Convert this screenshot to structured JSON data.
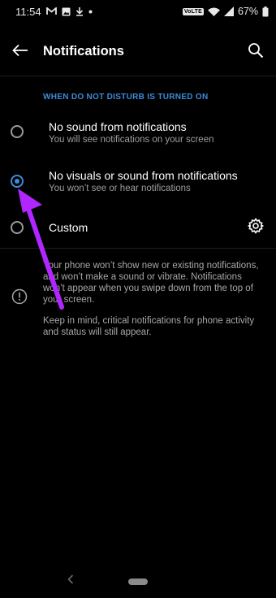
{
  "status_bar": {
    "time": "11:54",
    "volte_label": "VoLTE",
    "battery_percent": "67%",
    "left_icons": [
      "gmail-icon",
      "image-icon",
      "download-icon",
      "notification-dot-icon"
    ],
    "right_icons": [
      "wifi-icon",
      "signal-icon",
      "battery-icon"
    ]
  },
  "app_bar": {
    "title": "Notifications",
    "back_icon": "arrow-left-icon",
    "search_icon": "search-icon"
  },
  "section": {
    "header": "WHEN DO NOT DISTURB IS TURNED ON"
  },
  "options": [
    {
      "title": "No sound from notifications",
      "subtitle": "You will see notifications on your screen",
      "selected": false
    },
    {
      "title": "No visuals or sound from notifications",
      "subtitle": "You won’t see or hear notifications",
      "selected": true
    },
    {
      "title": "Custom",
      "subtitle": "",
      "selected": false
    }
  ],
  "info": {
    "paragraph1": "Your phone won’t show new or existing notifications, and won’t make a sound or vibrate. Notifications won’t appear when you swipe down from the top of your screen.",
    "paragraph2": "Keep in mind, critical notifications for phone activity and status will still appear."
  },
  "colors": {
    "accent": "#3d8bd9",
    "annotation_arrow": "#b026ff",
    "background": "#000000"
  }
}
